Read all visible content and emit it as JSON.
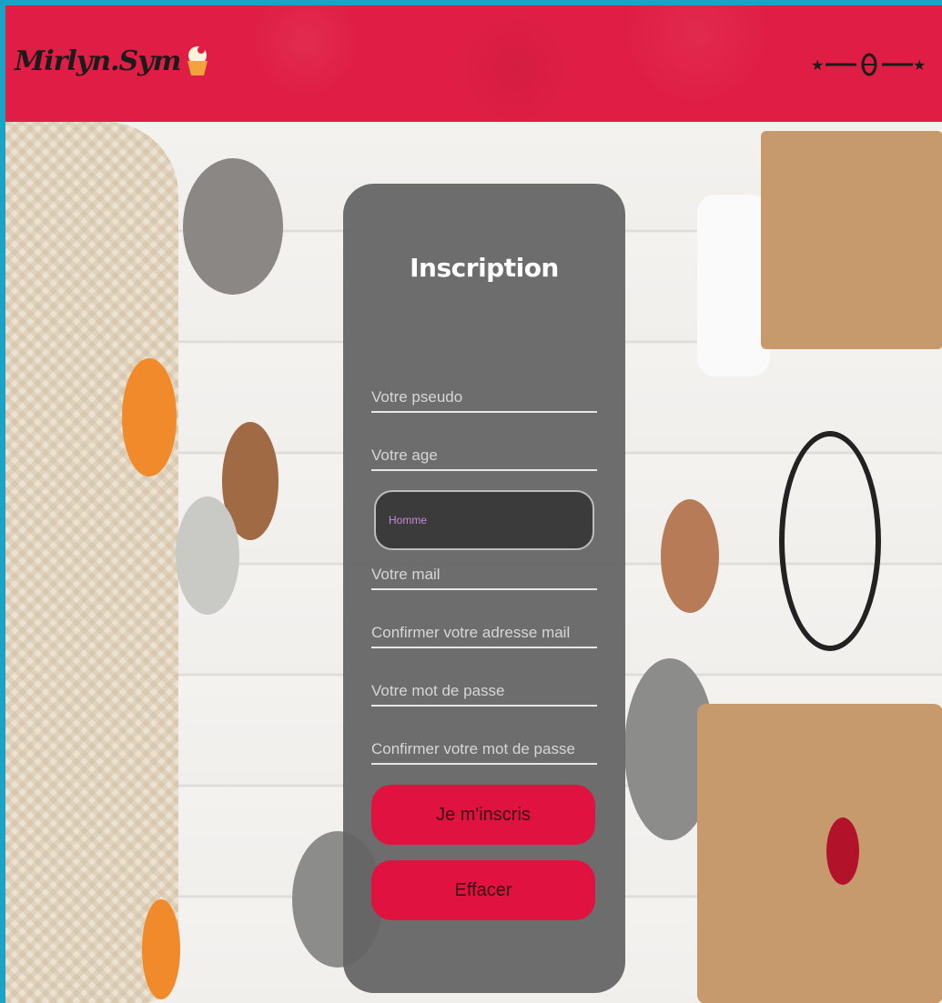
{
  "header": {
    "logo_text": "Mirlyn.Sym",
    "menu_icon": "ornament-menu-icon"
  },
  "form": {
    "title": "Inscription",
    "fields": {
      "pseudo_placeholder": "Votre pseudo",
      "age_placeholder": "Votre age",
      "gender_selected": "Homme",
      "mail_placeholder": "Votre mail",
      "mail_confirm_placeholder": "Confirmer votre adresse mail",
      "password_placeholder": "Votre mot de passe",
      "password_confirm_placeholder": "Confirmer votre mot de passe"
    },
    "buttons": {
      "submit_label": "Je m'inscris",
      "reset_label": "Effacer"
    }
  },
  "colors": {
    "header_bg": "#e01e45",
    "button_bg": "#e0123f",
    "panel_bg": "#636363",
    "page_border": "#1aa3c6"
  }
}
